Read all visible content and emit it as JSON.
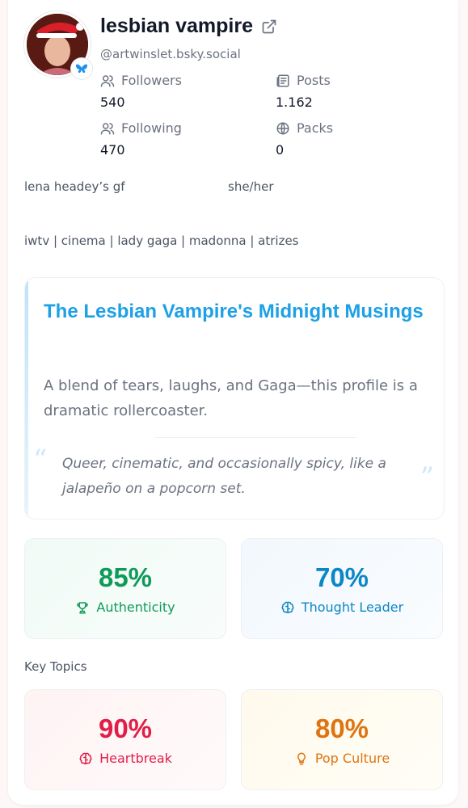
{
  "profile": {
    "display_name": "lesbian vampire",
    "handle": "@artwinslet.bsky.social",
    "external_link_icon": "external-link-icon",
    "verified_icon": "butterfly-icon"
  },
  "stats": {
    "followers": {
      "label": "Followers",
      "value": "540",
      "icon": "users-icon"
    },
    "posts": {
      "label": "Posts",
      "value": "1.162",
      "icon": "newspaper-icon"
    },
    "following": {
      "label": "Following",
      "value": "470",
      "icon": "users-icon"
    },
    "packs": {
      "label": "Packs",
      "value": "0",
      "icon": "globe-icon"
    }
  },
  "bio": {
    "line1_left": "lena headey’s gf",
    "line1_right": "she/her",
    "line2": "iwtv | cinema | lady gaga | madonna | atrizes"
  },
  "summary": {
    "title": "The Lesbian Vampire's Midnight Musings",
    "description": "A blend of tears, laughs, and Gaga—this profile is a dramatic rollercoaster.",
    "quote": "Queer, cinematic, and occasionally spicy, like a jalapeño on a popcorn set.",
    "quote_mark_open": "“",
    "quote_mark_close": "”"
  },
  "metrics": [
    {
      "value": "85%",
      "label": "Authenticity",
      "icon": "trophy-icon",
      "color": "#0e9a5a"
    },
    {
      "value": "70%",
      "label": "Thought Leader",
      "icon": "brain-icon",
      "color": "#0c87c6"
    }
  ],
  "topics_label": "Key Topics",
  "topics": [
    {
      "value": "90%",
      "label": "Heartbreak",
      "icon": "brain-icon",
      "color": "#e11d48"
    },
    {
      "value": "80%",
      "label": "Pop Culture",
      "icon": "lightbulb-icon",
      "color": "#de7410"
    }
  ]
}
